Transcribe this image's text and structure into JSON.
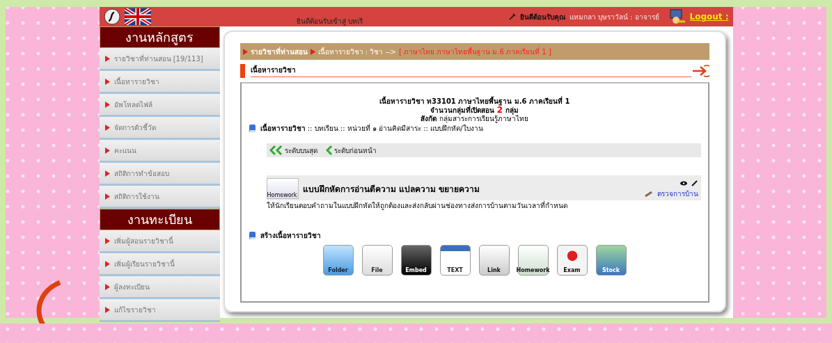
{
  "header": {
    "welcome": "ยินดีต้อนรับเข้าสู่ บทเรี",
    "user_label": "ยินดีต้อนรับคุณ",
    "user_name": "แหมกลา บุษราวัลน์ : อาจารย์",
    "logout": "Logout :"
  },
  "sidebar": [
    {
      "title": "งานหลักสูตร",
      "items": [
        "รายวิชาที่ท่านสอน [19/113]",
        "เนื้อหารายวิชา",
        "อัพโหลดไฟล์",
        "จัดการตัวชี้วัด",
        "คะแนน",
        "สถิติการทำข้อสอบ",
        "สถิติการใช้งาน"
      ]
    },
    {
      "title": "งานทะเบียน",
      "items": [
        "เพิ่มผู้สอนรายวิชานี้",
        "เพิ่มผู้เรียนรายวิชานี้",
        "ผู้ลงทะเบียน",
        "แก้ไขรายวิชา"
      ]
    }
  ],
  "breadcrumb": {
    "items": [
      "รายวิชาที่ท่านสอน",
      "เนื้อหารายวิชา  :  วิชา -->"
    ],
    "current": "[ ภาษาไทย ภาษาไทยพื้นฐาน ม.6 ภาคเรียนที่ 1 ]"
  },
  "section_title": "เนื้อหารายวิชา",
  "course": {
    "title": "เนื้อหารายวิชา ท33101 ภาษาไทยพื้นฐาน ม.6 ภาคเรียนที่ 1",
    "groups_label": "จำนวนกลุ่มที่เปิดสอน",
    "groups_count": "2",
    "groups_unit": "กลุ่ม",
    "affiliation_label": "สังกัด",
    "affiliation": "กลุ่มสาระการเรียนรู้ภาษาไทย"
  },
  "path": {
    "label": "เนื้อหารายวิชา",
    "rest": ":: บทเรียน :: หน่วยที่ ๑ อ่านคิดมีสาระ :: แบบฝึกหัด/ใบงาน"
  },
  "nav": [
    {
      "kind": "top",
      "label": "ระดับบนสุด"
    },
    {
      "kind": "back",
      "label": "ระดับก่อนหน้า"
    }
  ],
  "item": {
    "icon_label": "Homework",
    "title": "แบบฝึกหัดการอ่านตีความ แปลความ ขยายความ",
    "description": "ให้นักเรียนตอบคำถามในแบบฝึกหัดให้ถูกต้องและส่งกลับผ่านช่องทางส่งการบ้านตามวันเวลาที่กำหนด",
    "check_link": "ตรวจการบ้าน"
  },
  "create": {
    "title": "สร้างเนื้อหารายวิชา",
    "tools": [
      {
        "kind": "folder",
        "label": "Folder"
      },
      {
        "kind": "file",
        "label": "File"
      },
      {
        "kind": "embed",
        "label": "Embed"
      },
      {
        "kind": "text",
        "label": "TEXT"
      },
      {
        "kind": "link",
        "label": "Link"
      },
      {
        "kind": "homework",
        "label": "Homework"
      },
      {
        "kind": "exam",
        "label": "Exam"
      },
      {
        "kind": "stock",
        "label": "Stock"
      }
    ]
  }
}
